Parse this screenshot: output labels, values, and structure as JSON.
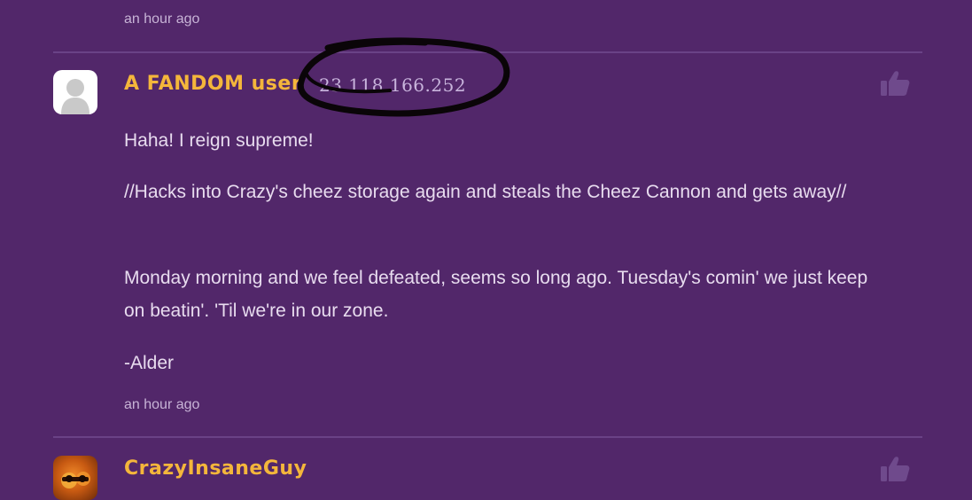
{
  "top": {
    "timestamp": "an hour ago"
  },
  "comment": {
    "author": "A FANDOM user",
    "ip": "23.118.166.252",
    "paragraphs": [
      "Haha! I reign supreme!",
      "//Hacks into Crazy's cheez storage again and steals the Cheez Cannon and gets away//",
      "Monday morning and we feel defeated, seems so long ago. Tuesday's comin' we just keep on beatin'. 'Til we're in our zone.",
      "-Alder"
    ],
    "timestamp": "an hour ago",
    "avatar_icon": "default-user-icon",
    "like_icon": "thumbs-up-icon"
  },
  "next_comment": {
    "author": "CrazyInsaneGuy",
    "avatar_icon": "user-avatar",
    "like_icon": "thumbs-up-icon"
  },
  "colors": {
    "background": "#52276a",
    "username": "#f4b63b",
    "text": "#e8dcef",
    "muted": "#c7b3d6",
    "divider": "#6a4286"
  }
}
